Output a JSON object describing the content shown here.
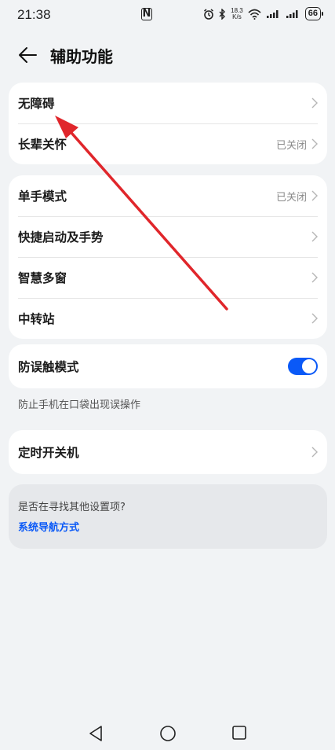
{
  "status_bar": {
    "time": "21:38",
    "speed_top": "18.3",
    "speed_bottom": "K/s",
    "battery": "66"
  },
  "header": {
    "title": "辅助功能"
  },
  "groups": {
    "g1": [
      {
        "label": "无障碍",
        "value": ""
      },
      {
        "label": "长辈关怀",
        "value": "已关闭"
      }
    ],
    "g2": [
      {
        "label": "单手模式",
        "value": "已关闭"
      },
      {
        "label": "快捷启动及手势",
        "value": ""
      },
      {
        "label": "智慧多窗",
        "value": ""
      },
      {
        "label": "中转站",
        "value": ""
      }
    ],
    "g3": {
      "label": "防误触模式",
      "toggle_on": true,
      "note": "防止手机在口袋出现误操作"
    },
    "g4": {
      "label": "定时开关机"
    }
  },
  "suggest": {
    "question": "是否在寻找其他设置项?",
    "link": "系统导航方式"
  },
  "colors": {
    "accent": "#0a59f7",
    "annotation": "#e0262b"
  }
}
